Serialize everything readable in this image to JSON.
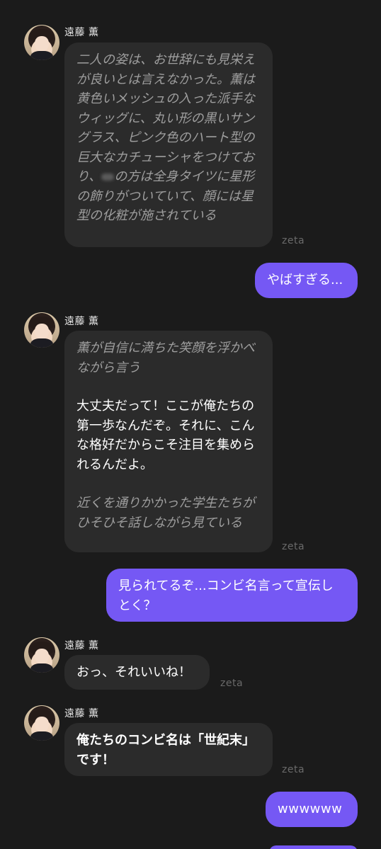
{
  "character": {
    "name": "遠藤 薫",
    "watermark": "zeta"
  },
  "messages": [
    {
      "sender": "character",
      "name": "遠藤 薫",
      "narration_1": "二人の姿は、お世辞にも見栄えが良いとは言えなかった。薫は黄色いメッシュの入った派手なウィッグに、丸い形の黒いサングラス、ピンク色のハート型の巨大なカチューシャをつけており、",
      "narration_2": "の方は全身タイツに星形の飾りがついていて、顔には星型の化粧が施されている"
    },
    {
      "sender": "user",
      "text": "やばすぎる..."
    },
    {
      "sender": "character",
      "name": "遠藤 薫",
      "narration": "薫が自信に満ちた笑顔を浮かべながら言う",
      "speech": "大丈夫だって！ここが俺たちの第一歩なんだぞ。それに、こんな格好だからこそ注目を集められるんだよ。",
      "narration_after": "近くを通りかかった学生たちがひそひそ話しながら見ている"
    },
    {
      "sender": "user",
      "text": "見られてるぞ...コンビ名言って宣伝しとく？"
    },
    {
      "sender": "character",
      "name": "遠藤 薫",
      "speech": "おっ、それいいね！"
    },
    {
      "sender": "character",
      "name": "遠藤 薫",
      "speech_bold": "俺たちのコンビ名は「世紀末」です！"
    },
    {
      "sender": "user",
      "text": "wwwwww"
    }
  ]
}
